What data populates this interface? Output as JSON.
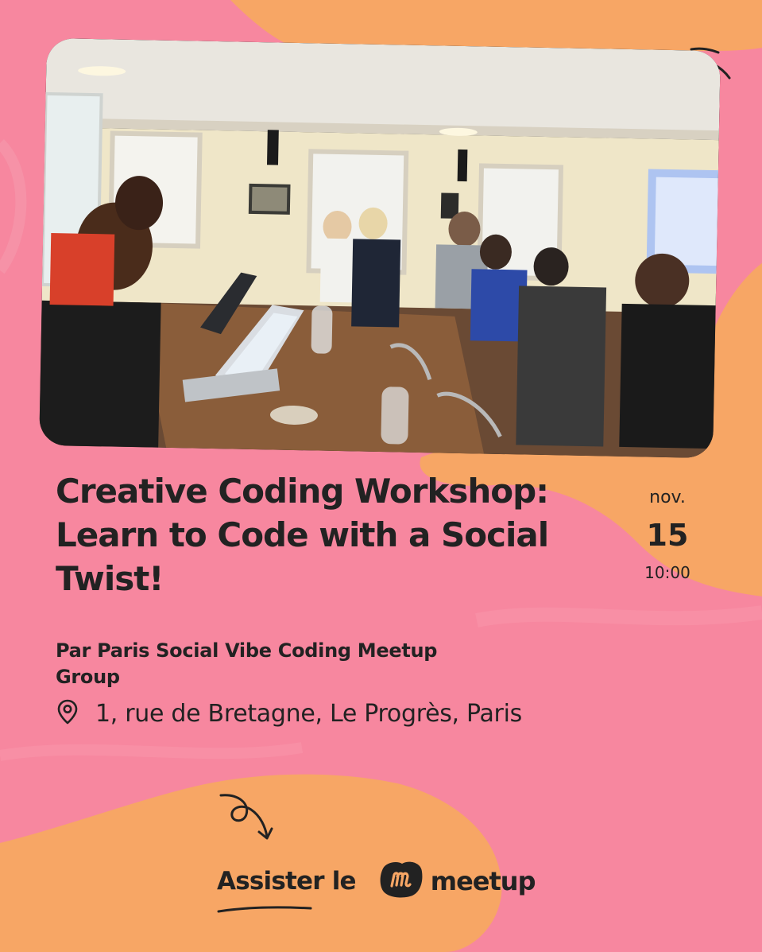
{
  "colors": {
    "background_pink": "#f7879f",
    "accent_orange": "#f7a665",
    "text_dark": "#222222"
  },
  "event": {
    "title": "Creative Coding Workshop: Learn to Code with a Social Twist!",
    "date": {
      "month": "nov.",
      "day": "15",
      "time": "10:00"
    },
    "organizer": "Par Paris Social Vibe Coding Meetup Group",
    "location": "1, rue de Bretagne, Le Progrès, Paris"
  },
  "photo": {
    "description_icon": "workshop-photo"
  },
  "cta": {
    "label": "Assister le",
    "brand": "meetup"
  },
  "icons": {
    "location": "map-pin-icon",
    "arrow": "curly-arrow-icon",
    "logo": "meetup-m-icon"
  }
}
